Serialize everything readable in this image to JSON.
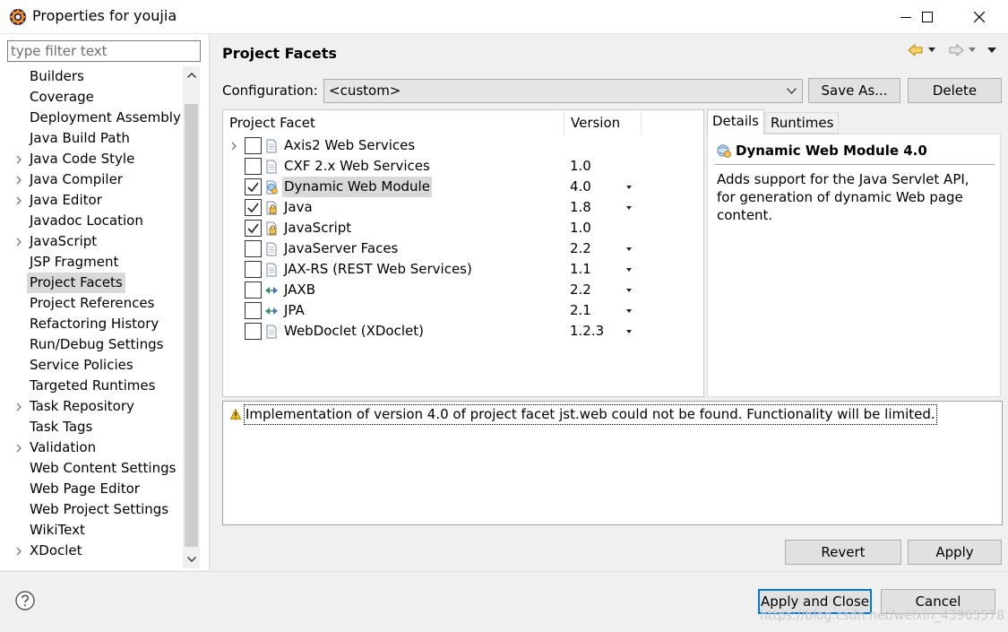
{
  "window": {
    "title": "Properties for youjia",
    "icon": "eclipse-gear-icon"
  },
  "filter": {
    "placeholder": "type filter text"
  },
  "tree": {
    "items": [
      {
        "label": "Builders",
        "expandable": false
      },
      {
        "label": "Coverage",
        "expandable": false
      },
      {
        "label": "Deployment Assembly",
        "expandable": false
      },
      {
        "label": "Java Build Path",
        "expandable": false
      },
      {
        "label": "Java Code Style",
        "expandable": true
      },
      {
        "label": "Java Compiler",
        "expandable": true
      },
      {
        "label": "Java Editor",
        "expandable": true
      },
      {
        "label": "Javadoc Location",
        "expandable": false
      },
      {
        "label": "JavaScript",
        "expandable": true
      },
      {
        "label": "JSP Fragment",
        "expandable": false
      },
      {
        "label": "Project Facets",
        "expandable": false,
        "selected": true
      },
      {
        "label": "Project References",
        "expandable": false
      },
      {
        "label": "Refactoring History",
        "expandable": false
      },
      {
        "label": "Run/Debug Settings",
        "expandable": false
      },
      {
        "label": "Service Policies",
        "expandable": false
      },
      {
        "label": "Targeted Runtimes",
        "expandable": false
      },
      {
        "label": "Task Repository",
        "expandable": true
      },
      {
        "label": "Task Tags",
        "expandable": false
      },
      {
        "label": "Validation",
        "expandable": true
      },
      {
        "label": "Web Content Settings",
        "expandable": false
      },
      {
        "label": "Web Page Editor",
        "expandable": false
      },
      {
        "label": "Web Project Settings",
        "expandable": false
      },
      {
        "label": "WikiText",
        "expandable": false
      },
      {
        "label": "XDoclet",
        "expandable": true
      }
    ]
  },
  "page": {
    "title": "Project Facets"
  },
  "config": {
    "label": "Configuration:",
    "value": "<custom>",
    "save_as": "Save As...",
    "delete": "Delete"
  },
  "facets": {
    "col_facet": "Project Facet",
    "col_version": "Version",
    "rows": [
      {
        "name": "Axis2 Web Services",
        "version": "",
        "checked": false,
        "icon": "document-icon",
        "expandable": true,
        "dropdown": false
      },
      {
        "name": "CXF 2.x Web Services",
        "version": "1.0",
        "checked": false,
        "icon": "document-icon",
        "expandable": false,
        "dropdown": false
      },
      {
        "name": "Dynamic Web Module",
        "version": "4.0",
        "checked": true,
        "icon": "web-module-icon",
        "expandable": false,
        "dropdown": true,
        "selected": true
      },
      {
        "name": "Java",
        "version": "1.8",
        "checked": true,
        "icon": "locked-facet-icon",
        "expandable": false,
        "dropdown": true
      },
      {
        "name": "JavaScript",
        "version": "1.0",
        "checked": true,
        "icon": "locked-facet-icon",
        "expandable": false,
        "dropdown": false
      },
      {
        "name": "JavaServer Faces",
        "version": "2.2",
        "checked": false,
        "icon": "document-icon",
        "expandable": false,
        "dropdown": true
      },
      {
        "name": "JAX-RS (REST Web Services)",
        "version": "1.1",
        "checked": false,
        "icon": "document-icon",
        "expandable": false,
        "dropdown": true
      },
      {
        "name": "JAXB",
        "version": "2.2",
        "checked": false,
        "icon": "bidirectional-arrow-icon",
        "expandable": false,
        "dropdown": true
      },
      {
        "name": "JPA",
        "version": "2.1",
        "checked": false,
        "icon": "bidirectional-arrow-icon",
        "expandable": false,
        "dropdown": true
      },
      {
        "name": "WebDoclet (XDoclet)",
        "version": "1.2.3",
        "checked": false,
        "icon": "document-icon",
        "expandable": false,
        "dropdown": true
      }
    ]
  },
  "details": {
    "tab_details": "Details",
    "tab_runtimes": "Runtimes",
    "title": "Dynamic Web Module 4.0",
    "description": "Adds support for the Java Servlet API, for generation of dynamic Web page content."
  },
  "problems": {
    "message": "Implementation of version 4.0 of project facet jst.web could not be found. Functionality will be limited."
  },
  "buttons": {
    "revert": "Revert",
    "apply": "Apply",
    "apply_and_close": "Apply and Close",
    "cancel": "Cancel"
  },
  "watermark": "https://blog.csdn.net/weixin_43965578",
  "colors": {
    "accent": "#0078d7",
    "selection": "#d9d9d9",
    "warning": "#f5c211"
  }
}
